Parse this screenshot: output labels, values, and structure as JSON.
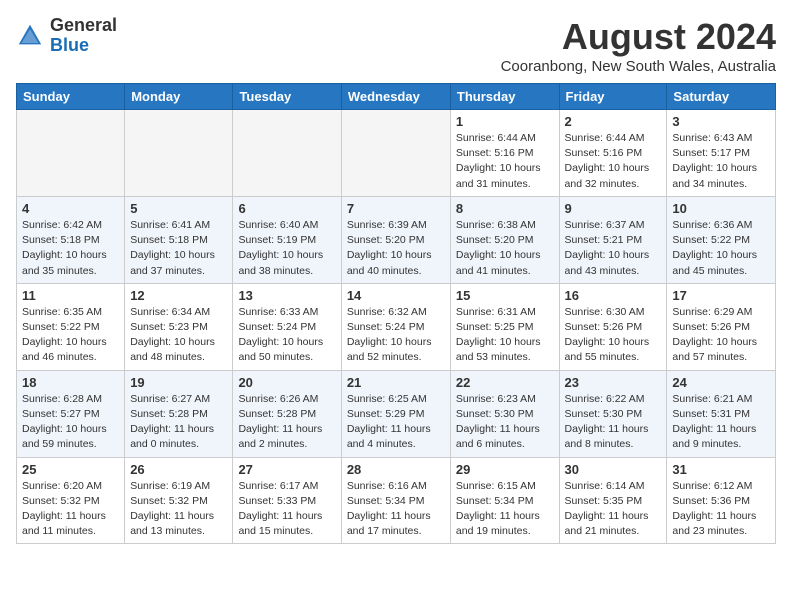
{
  "logo": {
    "general": "General",
    "blue": "Blue"
  },
  "title": "August 2024",
  "location": "Cooranbong, New South Wales, Australia",
  "days_of_week": [
    "Sunday",
    "Monday",
    "Tuesday",
    "Wednesday",
    "Thursday",
    "Friday",
    "Saturday"
  ],
  "weeks": [
    [
      {
        "day": "",
        "info": ""
      },
      {
        "day": "",
        "info": ""
      },
      {
        "day": "",
        "info": ""
      },
      {
        "day": "",
        "info": ""
      },
      {
        "day": "1",
        "info": "Sunrise: 6:44 AM\nSunset: 5:16 PM\nDaylight: 10 hours and 31 minutes."
      },
      {
        "day": "2",
        "info": "Sunrise: 6:44 AM\nSunset: 5:16 PM\nDaylight: 10 hours and 32 minutes."
      },
      {
        "day": "3",
        "info": "Sunrise: 6:43 AM\nSunset: 5:17 PM\nDaylight: 10 hours and 34 minutes."
      }
    ],
    [
      {
        "day": "4",
        "info": "Sunrise: 6:42 AM\nSunset: 5:18 PM\nDaylight: 10 hours and 35 minutes."
      },
      {
        "day": "5",
        "info": "Sunrise: 6:41 AM\nSunset: 5:18 PM\nDaylight: 10 hours and 37 minutes."
      },
      {
        "day": "6",
        "info": "Sunrise: 6:40 AM\nSunset: 5:19 PM\nDaylight: 10 hours and 38 minutes."
      },
      {
        "day": "7",
        "info": "Sunrise: 6:39 AM\nSunset: 5:20 PM\nDaylight: 10 hours and 40 minutes."
      },
      {
        "day": "8",
        "info": "Sunrise: 6:38 AM\nSunset: 5:20 PM\nDaylight: 10 hours and 41 minutes."
      },
      {
        "day": "9",
        "info": "Sunrise: 6:37 AM\nSunset: 5:21 PM\nDaylight: 10 hours and 43 minutes."
      },
      {
        "day": "10",
        "info": "Sunrise: 6:36 AM\nSunset: 5:22 PM\nDaylight: 10 hours and 45 minutes."
      }
    ],
    [
      {
        "day": "11",
        "info": "Sunrise: 6:35 AM\nSunset: 5:22 PM\nDaylight: 10 hours and 46 minutes."
      },
      {
        "day": "12",
        "info": "Sunrise: 6:34 AM\nSunset: 5:23 PM\nDaylight: 10 hours and 48 minutes."
      },
      {
        "day": "13",
        "info": "Sunrise: 6:33 AM\nSunset: 5:24 PM\nDaylight: 10 hours and 50 minutes."
      },
      {
        "day": "14",
        "info": "Sunrise: 6:32 AM\nSunset: 5:24 PM\nDaylight: 10 hours and 52 minutes."
      },
      {
        "day": "15",
        "info": "Sunrise: 6:31 AM\nSunset: 5:25 PM\nDaylight: 10 hours and 53 minutes."
      },
      {
        "day": "16",
        "info": "Sunrise: 6:30 AM\nSunset: 5:26 PM\nDaylight: 10 hours and 55 minutes."
      },
      {
        "day": "17",
        "info": "Sunrise: 6:29 AM\nSunset: 5:26 PM\nDaylight: 10 hours and 57 minutes."
      }
    ],
    [
      {
        "day": "18",
        "info": "Sunrise: 6:28 AM\nSunset: 5:27 PM\nDaylight: 10 hours and 59 minutes."
      },
      {
        "day": "19",
        "info": "Sunrise: 6:27 AM\nSunset: 5:28 PM\nDaylight: 11 hours and 0 minutes."
      },
      {
        "day": "20",
        "info": "Sunrise: 6:26 AM\nSunset: 5:28 PM\nDaylight: 11 hours and 2 minutes."
      },
      {
        "day": "21",
        "info": "Sunrise: 6:25 AM\nSunset: 5:29 PM\nDaylight: 11 hours and 4 minutes."
      },
      {
        "day": "22",
        "info": "Sunrise: 6:23 AM\nSunset: 5:30 PM\nDaylight: 11 hours and 6 minutes."
      },
      {
        "day": "23",
        "info": "Sunrise: 6:22 AM\nSunset: 5:30 PM\nDaylight: 11 hours and 8 minutes."
      },
      {
        "day": "24",
        "info": "Sunrise: 6:21 AM\nSunset: 5:31 PM\nDaylight: 11 hours and 9 minutes."
      }
    ],
    [
      {
        "day": "25",
        "info": "Sunrise: 6:20 AM\nSunset: 5:32 PM\nDaylight: 11 hours and 11 minutes."
      },
      {
        "day": "26",
        "info": "Sunrise: 6:19 AM\nSunset: 5:32 PM\nDaylight: 11 hours and 13 minutes."
      },
      {
        "day": "27",
        "info": "Sunrise: 6:17 AM\nSunset: 5:33 PM\nDaylight: 11 hours and 15 minutes."
      },
      {
        "day": "28",
        "info": "Sunrise: 6:16 AM\nSunset: 5:34 PM\nDaylight: 11 hours and 17 minutes."
      },
      {
        "day": "29",
        "info": "Sunrise: 6:15 AM\nSunset: 5:34 PM\nDaylight: 11 hours and 19 minutes."
      },
      {
        "day": "30",
        "info": "Sunrise: 6:14 AM\nSunset: 5:35 PM\nDaylight: 11 hours and 21 minutes."
      },
      {
        "day": "31",
        "info": "Sunrise: 6:12 AM\nSunset: 5:36 PM\nDaylight: 11 hours and 23 minutes."
      }
    ]
  ]
}
